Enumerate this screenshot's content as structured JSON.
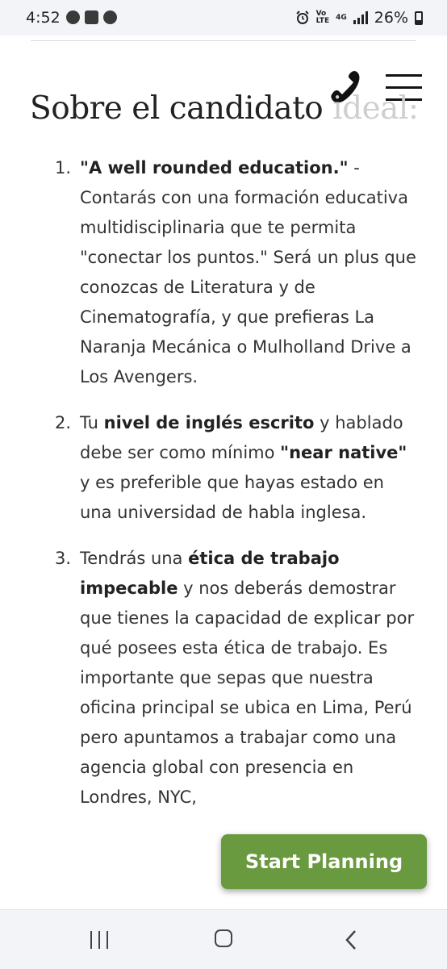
{
  "status_bar": {
    "time": "4:52",
    "volte_top": "Vo",
    "volte_bottom": "LTE",
    "network": "4G",
    "battery": "26%"
  },
  "header": {
    "title_main": "Sobre el candidato",
    "title_faded": " ideal:"
  },
  "list": [
    {
      "num": "1.",
      "bold1": "\"A well rounded education.\"",
      "text1": " - Contarás con una formación educativa multidisciplinaria que te permita \"conectar los puntos.\" Será un plus que conozcas de Literatura y de Cinematografía, y que prefieras La Naranja Mecánica o Mulholland Drive a Los Avengers."
    },
    {
      "num": "2.",
      "text1": "Tu ",
      "bold1": "nivel de inglés escrito",
      "text2": " y hablado debe ser como mínimo ",
      "bold2": "\"near native\"",
      "text3": " y es preferible que hayas estado en una universidad de habla inglesa."
    },
    {
      "num": "3.",
      "text1": "Tendrás una ",
      "bold1": "ética de trabajo impecable",
      "text2": " y nos deberás demostrar que tienes la capacidad de explicar por qué posees esta ética de trabajo. Es importante que sepas que nuestra oficina principal se ubica en Lima, Perú pero apuntamos a trabajar como una agencia global con presencia en Londres, NYC,"
    }
  ],
  "cta": {
    "label": "Start Planning"
  },
  "colors": {
    "accent": "#6a9a3f"
  },
  "icons": [
    "whatsapp-icon",
    "gallery-icon",
    "messenger-icon",
    "alarm-icon",
    "signal-icon",
    "battery-icon",
    "phone-icon",
    "menu-icon",
    "recents-icon",
    "home-icon",
    "back-icon"
  ]
}
